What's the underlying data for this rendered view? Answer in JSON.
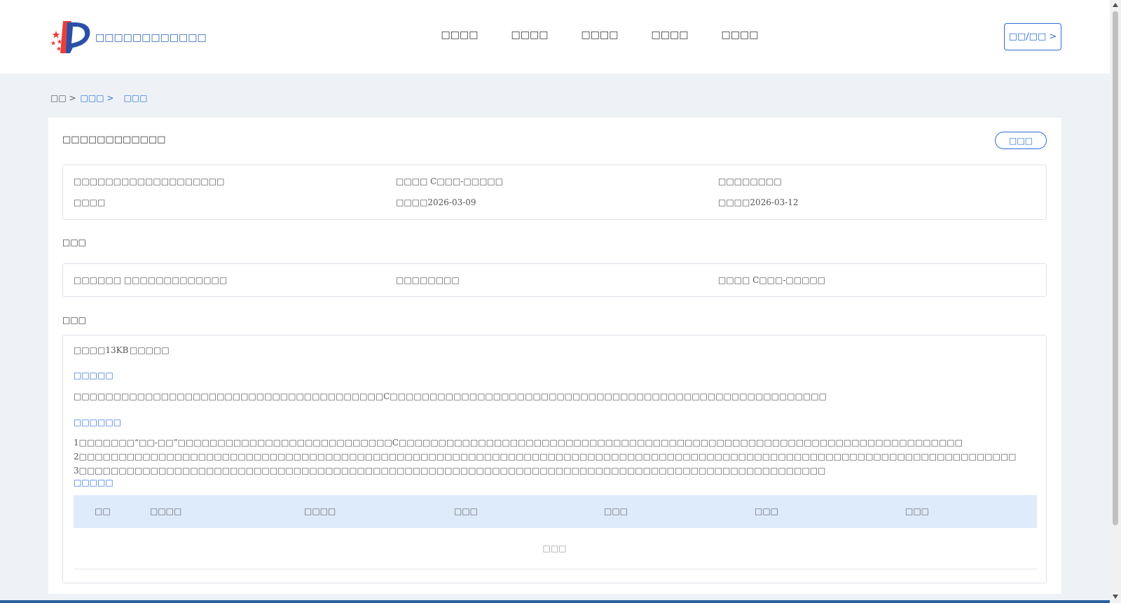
{
  "header": {
    "site_name": "□□□□□□□□□□□□",
    "nav": [
      "□□□□",
      "□□□□",
      "□□□□",
      "□□□□",
      "□□□□"
    ],
    "login_label": "□□/□□ >"
  },
  "breadcrumb": {
    "home": "□□ >",
    "level1": "□□□ >",
    "current": "□□□"
  },
  "detail": {
    "title": "□□□□□□□□□□□□",
    "back_label": "□□□",
    "info": {
      "r1c1": "□□□□□□□□□□□□□□□□□□□",
      "r1c2": "□□□□ C□□□-□□□□□",
      "r1c3": "□□□□□□□□",
      "r2c1": "□□□□",
      "r2c2": "□□□□2026-03-09",
      "r2c3": "□□□□2026-03-12"
    },
    "section1_title": "□□□",
    "section1": {
      "c1": "□□□□□□ □□□□□□□□□□□□□",
      "c2": "□□□□□□□□",
      "c3": "□□□□ C□□□-□□□□□"
    },
    "section2_title": "□□□",
    "section2": {
      "size": "□□□□13KB",
      "type": "□□□□□",
      "h1": "□□□□□",
      "p1": "□□□□□□□□□□□□□□□□□□□□□□□□□□□□□□□□□□□□□□□C□□□□□□□□□□□□□□□□□□□□□□□□□□□□□□□□□□□□□□□□□□□□□□□□□□□□□□□",
      "h2": "□□□□□□",
      "p2": "1□□□□□□□“□□-□□”□□□□□□□□□□□□□□□□□□□□□□□□□□□C□□□□□□□□□□□□□□□□□□□□□□□□□□□□□□□□□□□□□□□□□□□□□□□□□□□□□□□□□□□□□□□□□□□□□□□ 2□□□□□□□□□□□□□□□□□□□□□□□□□□□□□□□□□□□□□□□□□□□□□□□□□□□□□□□□□□□□□□□□□□□□□□□□□□□□□□□□□□□□□□□□□□□□□□□□□□□□□□□□□□□□□□□□□□□□□□ 3□□□□□□□□□□□□□□□□□□□□□□□□□□□□□□□□□□□□□□□□□□□□□□□□□□□□□□□□□□□□□□□□□□□□□□□□□□□□□□□□□□□□□□□□□□□□□□",
      "h3": "□□□□□",
      "table_headers": [
        "□□",
        "□□□□",
        "□□□□",
        "□□□",
        "□□□",
        "□□□",
        "□□□"
      ],
      "empty_text": "□□□"
    }
  },
  "colors": {
    "accent": "#2b6fd6",
    "table_header_bg": "#deebfb",
    "page_bg": "#eef2f6",
    "footer": "#2a5f9e"
  },
  "icons": {
    "logo": "stars-and-bars-logo-icon"
  }
}
